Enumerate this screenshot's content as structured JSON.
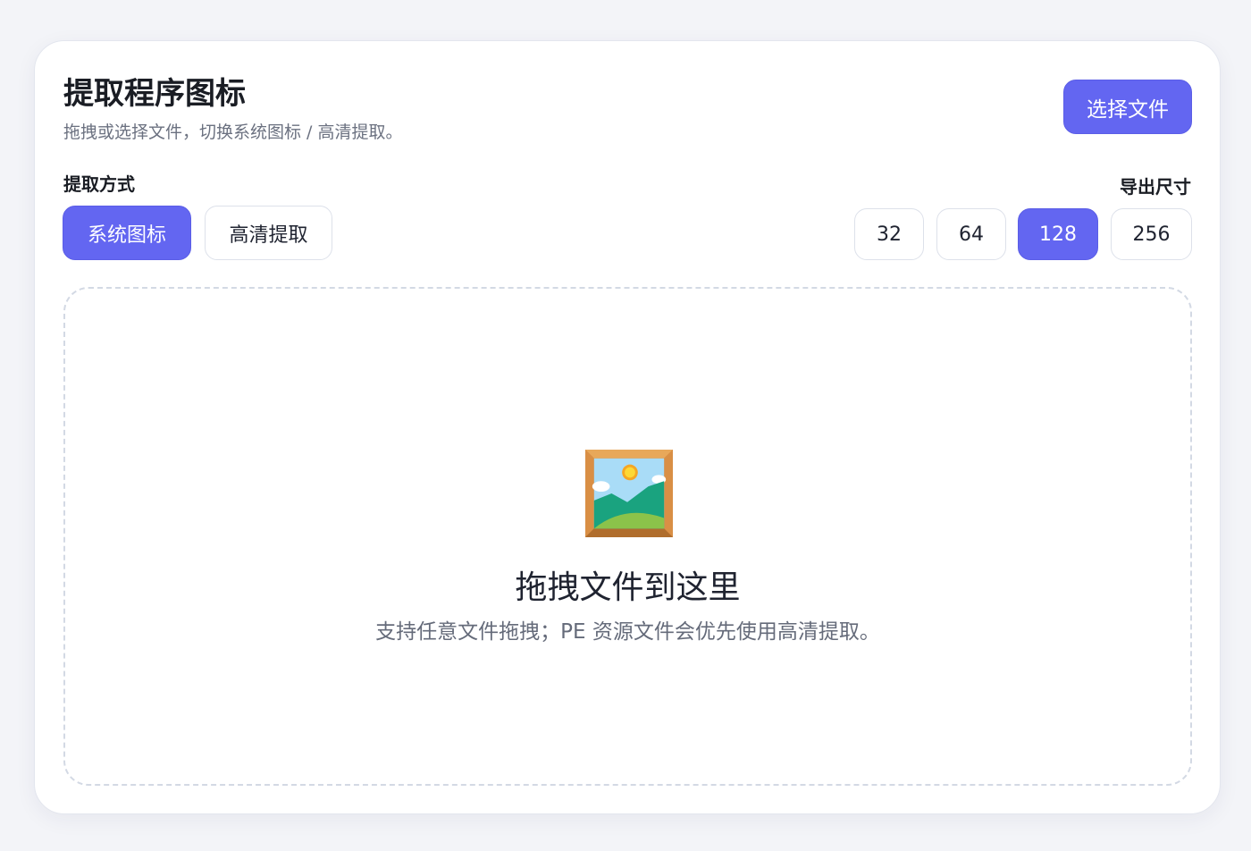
{
  "header": {
    "title": "提取程序图标",
    "subtitle": "拖拽或选择文件，切换系统图标 / 高清提取。",
    "select_file_label": "选择文件"
  },
  "mode": {
    "label": "提取方式",
    "options": [
      {
        "label": "系统图标",
        "selected": true
      },
      {
        "label": "高清提取",
        "selected": false
      }
    ]
  },
  "export_size": {
    "label": "导出尺寸",
    "options": [
      {
        "label": "32",
        "selected": false
      },
      {
        "label": "64",
        "selected": false
      },
      {
        "label": "128",
        "selected": true
      },
      {
        "label": "256",
        "selected": false
      }
    ]
  },
  "dropzone": {
    "icon": "framed-picture-icon",
    "title": "拖拽文件到这里",
    "hint": "支持任意文件拖拽；PE 资源文件会优先使用高清提取。"
  },
  "colors": {
    "accent": "#6366f1",
    "background": "#f3f4f8",
    "card": "#ffffff",
    "dashed_border": "#d3d9e4"
  }
}
